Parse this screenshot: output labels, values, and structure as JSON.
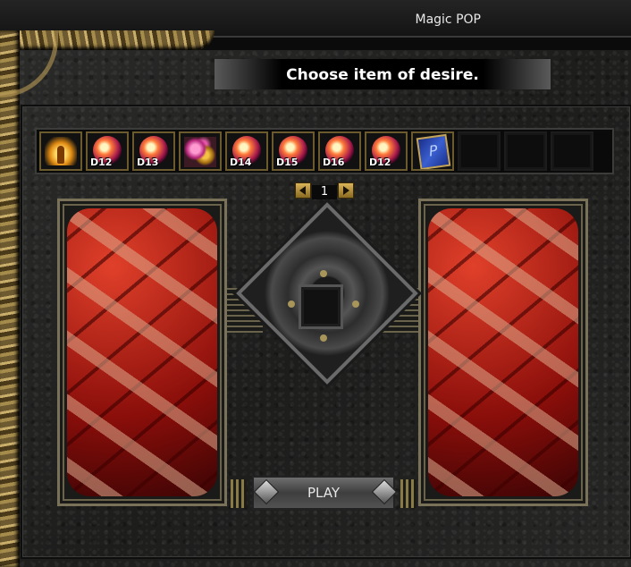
{
  "window": {
    "title": "Magic POP"
  },
  "header": {
    "prompt": "Choose item of desire."
  },
  "items": [
    {
      "icon": "golden-wings-icon",
      "label": ""
    },
    {
      "icon": "jewel-orb-icon",
      "label": "D12"
    },
    {
      "icon": "jewel-orb-icon",
      "label": "D13"
    },
    {
      "icon": "flower-pet-icon",
      "label": ""
    },
    {
      "icon": "jewel-orb-icon",
      "label": "D14"
    },
    {
      "icon": "jewel-orb-icon",
      "label": "D15"
    },
    {
      "icon": "jewel-orb-icon",
      "label": "D16"
    },
    {
      "icon": "jewel-orb-icon",
      "label": "D12"
    },
    {
      "icon": "blue-card-icon",
      "label": ""
    },
    {
      "icon": "empty-slot",
      "label": ""
    },
    {
      "icon": "empty-slot",
      "label": ""
    },
    {
      "icon": "empty-slot",
      "label": ""
    }
  ],
  "pager": {
    "page": "1"
  },
  "play": {
    "label": "PLAY"
  }
}
